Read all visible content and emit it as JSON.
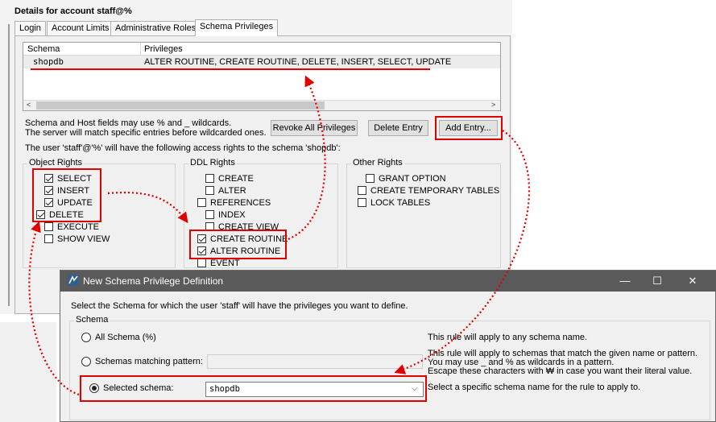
{
  "page": {
    "title": "Details for account staff@%"
  },
  "tabs": [
    {
      "label": "Login"
    },
    {
      "label": "Account Limits"
    },
    {
      "label": "Administrative Roles"
    },
    {
      "label": "Schema Privileges"
    }
  ],
  "grid": {
    "columns": [
      "Schema",
      "Privileges"
    ],
    "rows": [
      {
        "schema": "shopdb",
        "privileges": "ALTER ROUTINE, CREATE ROUTINE, DELETE, INSERT, SELECT, UPDATE"
      }
    ],
    "scroll_left": "<",
    "scroll_right": ">"
  },
  "info": {
    "line1": "Schema and Host fields may use % and _ wildcards.",
    "line2": "The server will match specific entries before wildcarded ones.",
    "access": "The user 'staff'@'%' will have the following access rights to the schema 'shopdb':"
  },
  "buttons": {
    "revoke": "Revoke All Privileges",
    "delete": "Delete Entry",
    "add": "Add Entry..."
  },
  "object_rights": {
    "title": "Object Rights",
    "items": [
      {
        "label": "SELECT",
        "checked": true
      },
      {
        "label": "INSERT",
        "checked": true
      },
      {
        "label": "UPDATE",
        "checked": true
      },
      {
        "label": "DELETE",
        "checked": true
      },
      {
        "label": "EXECUTE",
        "checked": false
      },
      {
        "label": "SHOW VIEW",
        "checked": false
      }
    ]
  },
  "ddl_rights": {
    "title": "DDL Rights",
    "items": [
      {
        "label": "CREATE",
        "checked": false
      },
      {
        "label": "ALTER",
        "checked": false
      },
      {
        "label": "REFERENCES",
        "checked": false
      },
      {
        "label": "INDEX",
        "checked": false
      },
      {
        "label": "CREATE VIEW",
        "checked": false
      },
      {
        "label": "CREATE ROUTINE",
        "checked": true
      },
      {
        "label": "ALTER ROUTINE",
        "checked": true
      },
      {
        "label": "EVENT",
        "checked": false
      }
    ]
  },
  "other_rights": {
    "title": "Other Rights",
    "items": [
      {
        "label": "GRANT OPTION",
        "checked": false
      },
      {
        "label": "CREATE TEMPORARY TABLES",
        "checked": false
      },
      {
        "label": "LOCK TABLES",
        "checked": false
      }
    ]
  },
  "dialog": {
    "title": "New Schema Privilege Definition",
    "controls": {
      "minimize": "—",
      "maximize": "☐",
      "close": "✕"
    },
    "intro": "Select the Schema for which the user 'staff' will have the privileges you want to define.",
    "group_label": "Schema",
    "options": [
      {
        "label": "All Schema (%)",
        "selected": false,
        "desc": [
          "This rule will apply to any schema name."
        ]
      },
      {
        "label": "Schemas matching pattern:",
        "selected": false,
        "desc": [
          "This rule will apply to schemas that match the given name or pattern.",
          "You may use _ and % as wildcards in a pattern.",
          "Escape these characters with ₩ in case you want their literal value."
        ]
      },
      {
        "label": "Selected schema:",
        "selected": true,
        "desc": [
          "Select a specific schema name for the rule to apply to."
        ]
      }
    ],
    "selected_schema_value": "shopdb",
    "combo_arrow": "⌵"
  },
  "colors": {
    "annotation": "#e00000",
    "titlebar": "#5a5a5a",
    "panel": "#f0f0f0"
  },
  "icons": {
    "app_logo": "mysql-workbench-logo-icon"
  }
}
